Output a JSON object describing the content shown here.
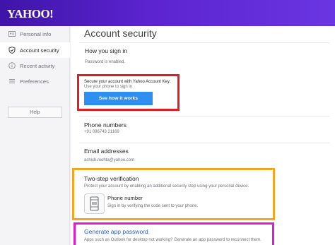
{
  "header": {
    "logo": "YAHOO!"
  },
  "sidebar": {
    "items": [
      {
        "label": "Personal info",
        "icon": "id-card-icon"
      },
      {
        "label": "Account security",
        "icon": "shield-icon"
      },
      {
        "label": "Recent activity",
        "icon": "info-icon"
      },
      {
        "label": "Preferences",
        "icon": "list-icon"
      }
    ],
    "help_label": "Help"
  },
  "main": {
    "title": "Account security",
    "sign_in": {
      "title": "How you sign in",
      "status": "Password is enabled.",
      "account_key_line1": "Secure your account with Yahoo Account Key.",
      "account_key_line2": "Use your phone to sign in",
      "button_label": "See how it works"
    },
    "phone": {
      "title": "Phone numbers",
      "value": "+91 096743 21169"
    },
    "email": {
      "title": "Email addresses",
      "value": "ashish.mohta@yahoo.com"
    },
    "two_step": {
      "title": "Two-step verification",
      "desc": "Protect your account by enabling an additional security step using your personal device.",
      "option_title": "Phone number",
      "option_desc": "Sign in by verifying the code sent to your phone."
    },
    "app_password": {
      "title": "Generate app password",
      "desc": "Apps such as Outlook for desktop not working? Generate an app password to reconnect them."
    }
  },
  "colors": {
    "header_purple": "#5b24d0",
    "button_blue": "#2e8ff0",
    "highlight_red": "#e01d25",
    "highlight_orange": "#f5a623",
    "highlight_magenta": "#e019d8"
  }
}
